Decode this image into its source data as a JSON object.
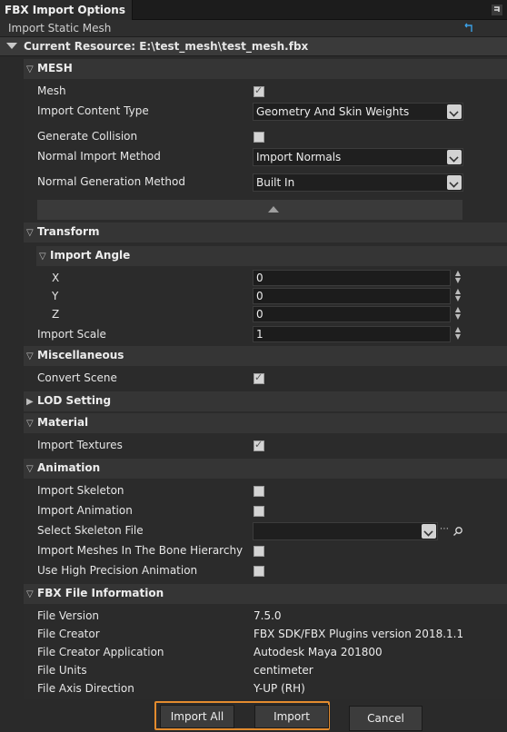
{
  "window": {
    "title": "FBX Import Options",
    "subtitle": "Import Static Mesh"
  },
  "resource": {
    "label": "Current Resource: E:\\test_mesh\\test_mesh.fbx"
  },
  "mesh": {
    "header": "MESH",
    "mesh_label": "Mesh",
    "content_type_label": "Import Content Type",
    "content_type_value": "Geometry And Skin Weights",
    "generate_collision_label": "Generate Collision",
    "normal_import_label": "Normal Import Method",
    "normal_import_value": "Import Normals",
    "normal_gen_label": "Normal Generation Method",
    "normal_gen_value": "Built In"
  },
  "transform": {
    "header": "Transform",
    "import_angle_header": "Import Angle",
    "x_label": "X",
    "x_value": "0",
    "y_label": "Y",
    "y_value": "0",
    "z_label": "Z",
    "z_value": "0",
    "scale_label": "Import Scale",
    "scale_value": "1"
  },
  "misc": {
    "header": "Miscellaneous",
    "convert_scene_label": "Convert Scene"
  },
  "lod": {
    "header": "LOD Setting"
  },
  "material": {
    "header": "Material",
    "import_textures_label": "Import Textures"
  },
  "animation": {
    "header": "Animation",
    "import_skeleton_label": "Import Skeleton",
    "import_animation_label": "Import Animation",
    "select_skeleton_label": "Select Skeleton File",
    "select_skeleton_value": "",
    "meshes_bone_label": "Import Meshes In The Bone Hierarchy",
    "high_precision_label": "Use High Precision Animation"
  },
  "fbx_info": {
    "header": "FBX File Information",
    "rows": [
      {
        "label": "File Version",
        "value": "7.5.0"
      },
      {
        "label": "File Creator",
        "value": "FBX SDK/FBX Plugins version 2018.1.1"
      },
      {
        "label": "File Creator Application",
        "value": "Autodesk Maya 201800"
      },
      {
        "label": "File Units",
        "value": "centimeter"
      },
      {
        "label": "File Axis Direction",
        "value": "Y-UP (RH)"
      }
    ]
  },
  "footer": {
    "import_all": "Import All",
    "import": "Import",
    "cancel": "Cancel"
  },
  "checks": {
    "mesh": true,
    "generate_collision": false,
    "convert_scene": true,
    "import_textures": true,
    "import_skeleton": false,
    "import_animation": false,
    "meshes_bone": false,
    "high_precision": false
  },
  "colors": {
    "highlight": "#e38b2e",
    "background": "#2a2a2a",
    "section": "#353535"
  },
  "icons": {
    "pin": "pin-icon",
    "restore": "restore-icon",
    "collapse": "collapse-up-icon",
    "browse": "browse-icon",
    "search": "search-icon"
  }
}
